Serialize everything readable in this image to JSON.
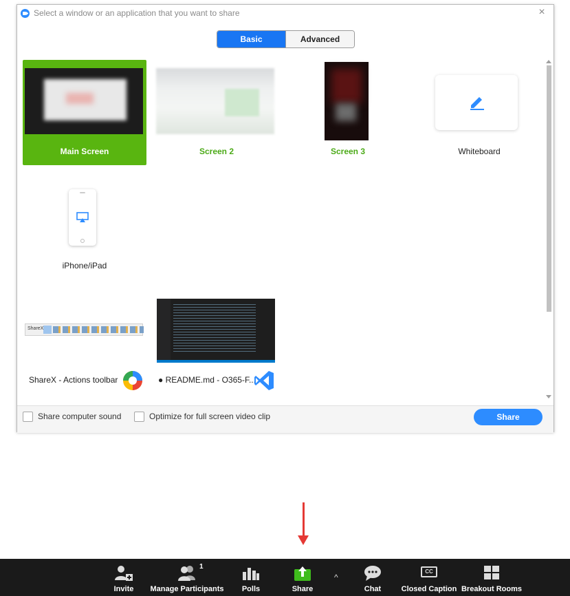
{
  "window": {
    "title": "Select a window or an application that you want to share",
    "close": "×"
  },
  "tabs": [
    {
      "label": "Basic",
      "active": true
    },
    {
      "label": "Advanced",
      "active": false
    }
  ],
  "tiles": {
    "main_screen": "Main Screen",
    "screen2": "Screen 2",
    "screen3": "Screen 3",
    "whiteboard": "Whiteboard",
    "iphone": "iPhone/iPad",
    "sharex": "ShareX - Actions toolbar",
    "readme": "● README.md - O365-F...",
    "sharex_toolbar_text": "ShareX"
  },
  "footer": {
    "share_sound": "Share computer sound",
    "optimize": "Optimize for full screen video clip",
    "share_button": "Share"
  },
  "toolbar": {
    "invite": "Invite",
    "manage_participants": "Manage Participants",
    "participants_count": "1",
    "polls": "Polls",
    "share": "Share",
    "caret": "^",
    "chat": "Chat",
    "closed_caption": "Closed Caption",
    "cc_icon_text": "CC",
    "breakout_rooms": "Breakout Rooms"
  },
  "colors": {
    "accent_blue": "#2d8cff",
    "selected_green": "#59b510",
    "label_green": "#4caa18",
    "arrow_red": "#e53935",
    "toolbar_bg": "#1a1a1a"
  },
  "icons": [
    "zoom-app-icon",
    "close-icon",
    "pencil-icon",
    "airplay-icon",
    "sharex-logo-icon",
    "vscode-logo-icon",
    "invite-icon",
    "participants-icon",
    "polls-icon",
    "share-icon",
    "chat-icon",
    "cc-icon",
    "breakout-rooms-icon"
  ]
}
